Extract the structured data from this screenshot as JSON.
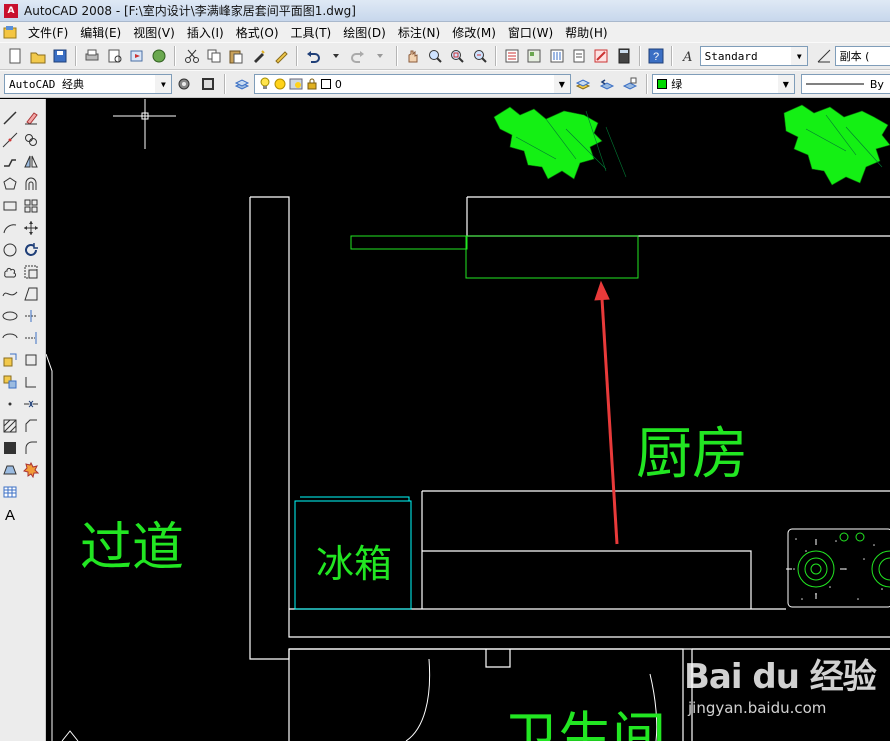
{
  "window": {
    "title": "AutoCAD 2008 - [F:\\室内设计\\李满峰家居套间平面图1.dwg]"
  },
  "menu": [
    "文件(F)",
    "编辑(E)",
    "视图(V)",
    "插入(I)",
    "格式(O)",
    "工具(T)",
    "绘图(D)",
    "标注(N)",
    "修改(M)",
    "窗口(W)",
    "帮助(H)"
  ],
  "toolbar": {
    "text_style": "Standard",
    "dim_style": "副本 (",
    "workspace": "AutoCAD 经典",
    "layer": "0",
    "color": "绿",
    "linetype": "By"
  },
  "drawing": {
    "rooms": {
      "kitchen": "厨房",
      "corridor": "过道",
      "fridge": "冰箱",
      "bathroom": "卫生间"
    }
  },
  "watermark": {
    "brand": "Bai du 经验",
    "url": "jingyan.baidu.com"
  },
  "colors": {
    "canvas_bg": "#000000",
    "cad_green": "#22e622",
    "cad_cyan": "#00ffff",
    "arrow_red": "#e83a3a"
  }
}
